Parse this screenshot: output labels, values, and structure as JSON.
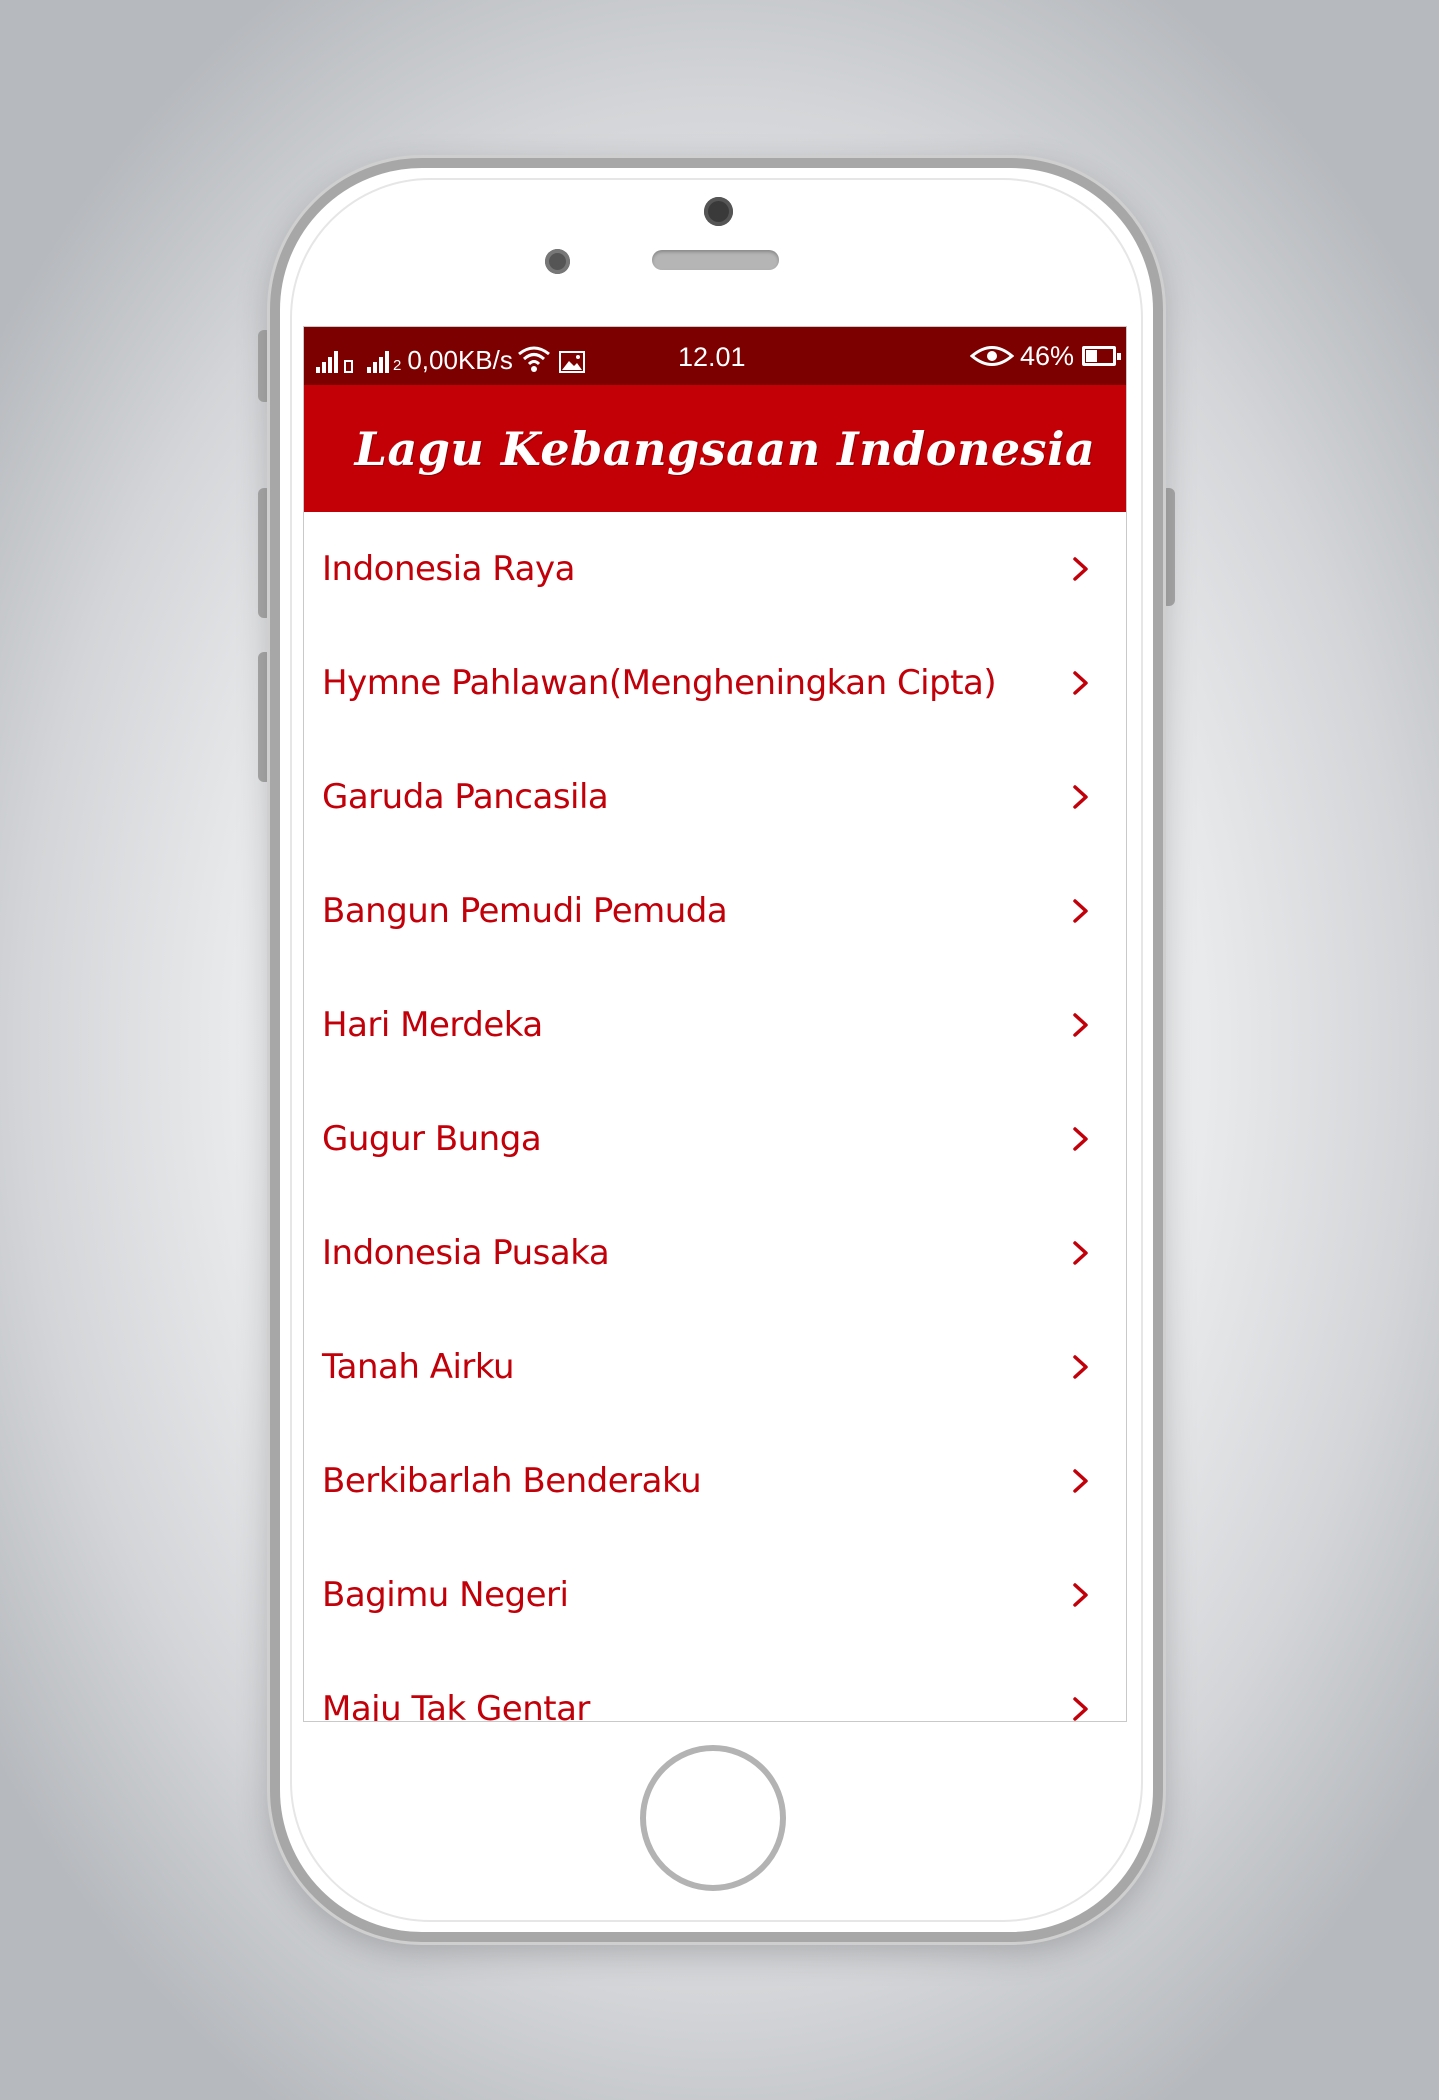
{
  "status_bar": {
    "sim1_label": "",
    "sim2_label": "2",
    "network_speed": "0,00KB/s",
    "time": "12.01",
    "battery_percent_label": "46%",
    "battery_level": 0.46,
    "icons": [
      "signal-icon",
      "sim-icon",
      "wifi-icon",
      "image-icon",
      "eye-icon",
      "battery-icon"
    ]
  },
  "app_bar": {
    "title": "Lagu Kebangsaan Indonesia"
  },
  "songs": [
    {
      "title": "Indonesia Raya"
    },
    {
      "title": "Hymne Pahlawan(Mengheningkan Cipta)"
    },
    {
      "title": "Garuda Pancasila"
    },
    {
      "title": "Bangun Pemudi Pemuda"
    },
    {
      "title": "Hari Merdeka"
    },
    {
      "title": "Gugur Bunga"
    },
    {
      "title": "Indonesia Pusaka"
    },
    {
      "title": "Tanah Airku"
    },
    {
      "title": "Berkibarlah Benderaku"
    },
    {
      "title": "Bagimu Negeri"
    },
    {
      "title": "Maju Tak Gentar"
    }
  ],
  "colors": {
    "status_bar": "#7c0000",
    "app_bar": "#c30006",
    "list_text": "#c10009",
    "background": "#ffffff"
  }
}
